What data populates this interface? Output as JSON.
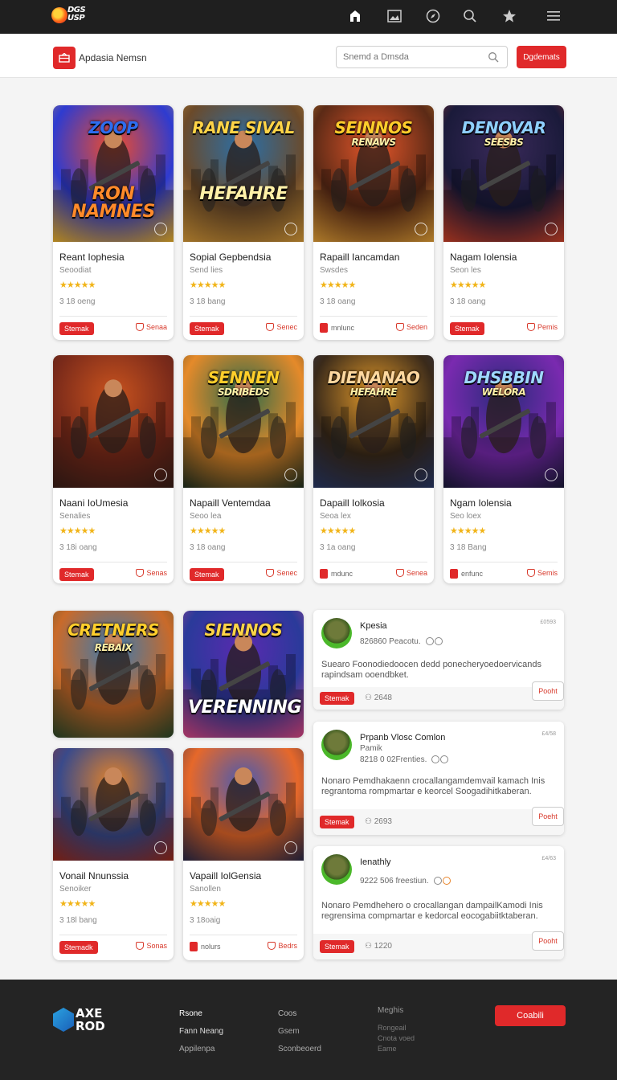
{
  "topbar": {
    "logo_text": "DGS\nUSP",
    "icons": [
      "home-icon",
      "image-icon",
      "compass-icon",
      "search-icon",
      "star-icon",
      "menu-icon"
    ]
  },
  "subheader": {
    "brand_name": "Apdasia Nemsn",
    "search_placeholder": "Snemd a Dmsda",
    "cta_label": "Dgdemats"
  },
  "games": [
    {
      "title": "Reant Iophesia",
      "sub": "Seoodiat",
      "rating": "★★★★★",
      "meta": "3 18 oeng",
      "action": "Stemak",
      "save": "Senaa",
      "art": "ZOOP",
      "art2": "RON NAMNES"
    },
    {
      "title": "Sopial Gepbendsia",
      "sub": "Send lies",
      "rating": "★★★★★",
      "meta": "3 18 bang",
      "action": "Stemak",
      "save": "Senec",
      "art": "RANE SIVAL",
      "art2": "HEFAHRE"
    },
    {
      "title": "Rapaill Iancamdan",
      "sub": "Swsdes",
      "rating": "★★★★★",
      "meta": "3 18 oang",
      "action": "mnlunc",
      "save": "Seden",
      "art": "SEINNOS",
      "art2": "RENAWS"
    },
    {
      "title": "Nagam Iolensia",
      "sub": "Seon les",
      "rating": "★★★★★",
      "meta": "3 18 oang",
      "action": "Stemak",
      "save": "Pemis",
      "art": "DENOVAR",
      "art2": "SEESBS"
    },
    {
      "title": "Naani IoUmesia",
      "sub": "Senalies",
      "rating": "★★★★★",
      "meta": "3 18i oang",
      "action": "Stemak",
      "save": "Senas",
      "art": "",
      "art2": ""
    },
    {
      "title": "Napaill Ventemdaa",
      "sub": "Seoo lea",
      "rating": "★★★★★",
      "meta": "3 18 oang",
      "action": "Stemak",
      "save": "Senec",
      "art": "SENNEN",
      "art2": "SDRIBEDS"
    },
    {
      "title": "Dapaill Iolkosia",
      "sub": "Seoa lex",
      "rating": "★★★★★",
      "meta": "3 1a oang",
      "action": "mdunc",
      "save": "Senea",
      "art": "DIENANAO",
      "art2": "HEFAHRE"
    },
    {
      "title": "Ngam Iolensia",
      "sub": "Seo loex",
      "rating": "★★★★★",
      "meta": "3 18 Bang",
      "action": "enfunc",
      "save": "Semis",
      "art": "DHSBBIN",
      "art2": "WELORA"
    },
    {
      "title": "",
      "sub": "",
      "rating": "",
      "meta": "",
      "action": "",
      "save": "",
      "art": "CRETNERS",
      "art2": "REBAIX"
    },
    {
      "title": "",
      "sub": "",
      "rating": "",
      "meta": "",
      "action": "",
      "save": "",
      "art": "SIENNOS",
      "art2": "VERENNING"
    },
    {
      "title": "Vonail Nnunssia",
      "sub": "Senoiker",
      "rating": "★★★★★",
      "meta": "3 18l bang",
      "action": "Stemadk",
      "save": "Sonas",
      "art": "",
      "art2": ""
    },
    {
      "title": "Vapaill IolGensia",
      "sub": "Sanollen",
      "rating": "★★★★★",
      "meta": "3 18oaig",
      "action": "nolurs",
      "save": "Bedrs",
      "art": "",
      "art2": ""
    }
  ],
  "reviews": [
    {
      "name": "Kpesia",
      "sub": "826860 Peacotu.",
      "time": "£0593",
      "body": "Suearo Foonodiedoocen dedd ponecheryoedoervicands rapindsam ooendbket.",
      "action": "Stemak",
      "count": "2648",
      "reply": "Pooht"
    },
    {
      "name": "Prpanb Vlosc Comlon",
      "sub": "Pamik",
      "sub2": "8218 0 02Frenties.",
      "time": "£4/58",
      "body": "Nonaro Pemdhakaenn crocallangamdemvail kamach Inis regrantoma rompmartar e keorcel Soogadihitkaberan.",
      "action": "Stemak",
      "count": "2693",
      "reply": "Poeht"
    },
    {
      "name": "Ienathly",
      "sub": "9222 506 freestiun.",
      "time": "£4/63",
      "body": "Nonaro Pemdhehero o crocallangan dampailKamodi Inis regrensima compmartar e kedorcal eocogabiitktaberan.",
      "action": "Stemak",
      "count": "1220",
      "reply": "Pooht"
    }
  ],
  "footer": {
    "logo_line1": "AXE",
    "logo_line2": "ROD",
    "col1": [
      "Rsone",
      "Fann Neang",
      "Appilenpa"
    ],
    "col2": [
      "Coos",
      "Gsem",
      "Sconbeoerd"
    ],
    "col3": [
      "Meghis",
      "Rongeail",
      "Cnota voed",
      "Eame"
    ],
    "cta": "Coabili"
  }
}
